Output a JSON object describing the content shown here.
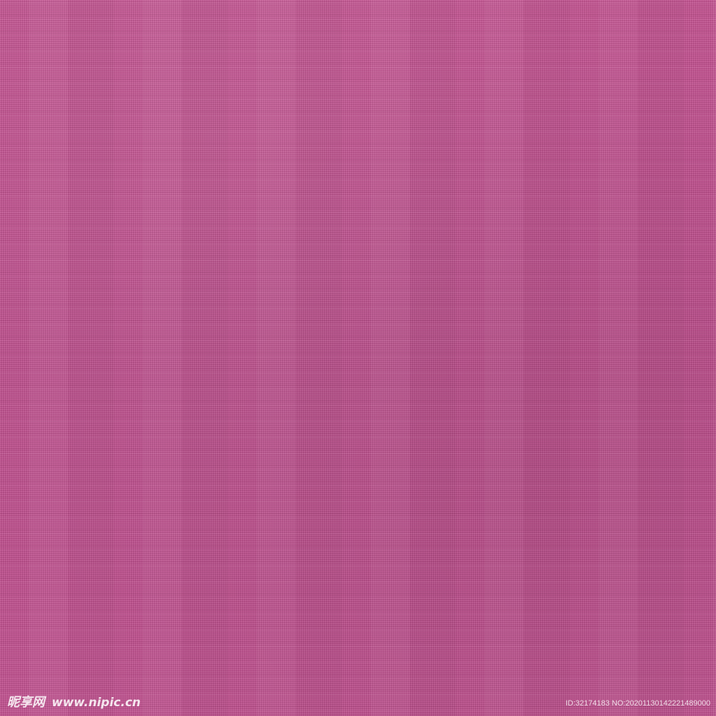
{
  "image": {
    "description_color": "#c1518f"
  },
  "watermark": {
    "logo_text": "昵享网",
    "url": "www.nipic.cn",
    "id_text": "ID:32174183 NO:20201130142221489000"
  },
  "colors": {
    "fabric_pink": "#c1518f",
    "watermark_text": "#ffffff"
  }
}
